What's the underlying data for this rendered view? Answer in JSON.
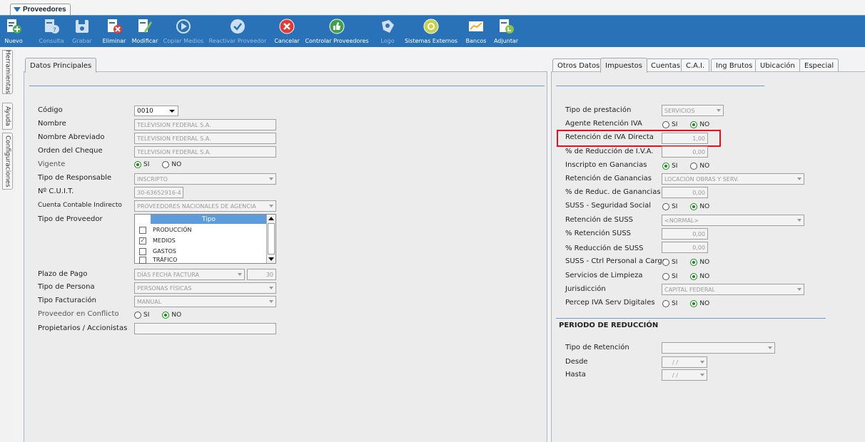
{
  "window": {
    "tab_title": "Proveedores"
  },
  "toolbar": [
    {
      "label": "Nuevo",
      "icon": "new-doc-icon",
      "enabled": true
    },
    {
      "label": "Consulta",
      "icon": "query-doc-icon",
      "enabled": false
    },
    {
      "label": "Grabar",
      "icon": "save-icon",
      "enabled": false
    },
    {
      "label": "Eliminar",
      "icon": "delete-doc-icon",
      "enabled": true
    },
    {
      "label": "Modificar",
      "icon": "edit-icon",
      "enabled": true
    },
    {
      "label": "Copiar Medios",
      "icon": "play-circle-icon",
      "enabled": false
    },
    {
      "label": "Reactivar Proveedor",
      "icon": "check-circle-icon",
      "enabled": false
    },
    {
      "label": "Cancelar",
      "icon": "cancel-icon",
      "enabled": true
    },
    {
      "label": "Controlar Proveedores",
      "icon": "thumbs-up-icon",
      "enabled": true
    },
    {
      "label": "Logo",
      "icon": "logo-icon",
      "enabled": false
    },
    {
      "label": "Sistemas Externos",
      "icon": "external-systems-icon",
      "enabled": true
    },
    {
      "label": "Bancos",
      "icon": "chart-icon",
      "enabled": true
    },
    {
      "label": "Adjuntar",
      "icon": "attach-doc-icon",
      "enabled": true
    }
  ],
  "side_tabs": [
    "Herramientas",
    "Ayuda",
    "Configuraciones"
  ],
  "left": {
    "tab": "Datos Principales",
    "codigo_label": "Código",
    "codigo_value": "0010",
    "nombre_label": "Nombre",
    "nombre_value": "TELEVISION FEDERAL S.A.",
    "nombre_abrev_label": "Nombre Abreviado",
    "nombre_abrev_value": "TELEVISION FEDERAL S.A.",
    "orden_label": "Orden del Cheque",
    "orden_value": "TELEVISION FEDERAL S.A.",
    "vigente_label": "Vigente",
    "tipo_resp_label": "Tipo de Responsable",
    "tipo_resp_value": "INSCRIPTO",
    "cuit_label": "Nº C.U.I.T.",
    "cuit_value": "30-63652916-4",
    "cuenta_label": "Cuenta Contable Indirecto",
    "cuenta_value": "PROVEEDORES NACIONALES DE AGENCIA",
    "tipo_prov_label": "Tipo de Proveedor",
    "grid_header": "Tipo",
    "grid_rows": [
      {
        "label": "PRODUCCIÓN",
        "checked": false
      },
      {
        "label": "MEDIOS",
        "checked": true
      },
      {
        "label": "GASTOS",
        "checked": false
      },
      {
        "label": "TRÁFICO",
        "checked": false
      }
    ],
    "plazo_label": "Plazo de Pago",
    "plazo_value": "DÍAS FECHA FACTURA",
    "plazo_days": "30",
    "tipo_persona_label": "Tipo de Persona",
    "tipo_persona_value": "PERSONAS FÍSICAS",
    "tipo_fact_label": "Tipo Facturación",
    "tipo_fact_value": "MANUAL",
    "conflicto_label": "Proveedor en Conflicto",
    "propietarios_label": "Propietarios / Accionistas",
    "propietarios_value": "",
    "si_label": "SI",
    "no_label": "NO"
  },
  "right": {
    "tabs": [
      "Otros Datos",
      "Impuestos",
      "Cuentas",
      "C.A.I.",
      "Ing Brutos",
      "Ubicación",
      "Especial"
    ],
    "active_tab": "Impuestos",
    "tipo_prest_label": "Tipo de prestación",
    "tipo_prest_value": "SERVICIOS",
    "agente_ret_iva_label": "Agente Retención IVA",
    "ret_iva_directa_label": "Retención de IVA Directa",
    "ret_iva_directa_value": "1,00",
    "red_iva_label": "% de Reducción de I.V.A.",
    "red_iva_value": "0,00",
    "inscripto_gan_label": "Inscripto en Ganancias",
    "ret_gan_label": "Retención de Ganancias",
    "ret_gan_value": "LOCACIÓN OBRAS Y SERV.",
    "red_gan_label": "% de Reduc. de Ganancias",
    "red_gan_value": "0,00",
    "suss_label": "SUSS - Seguridad Social",
    "ret_suss_label": "Retención de SUSS",
    "ret_suss_value": "<NORMAL>",
    "pct_ret_suss_label": "% Retención SUSS",
    "pct_ret_suss_value": "0,00",
    "pct_red_suss_label": "% Reducción de SUSS",
    "pct_red_suss_value": "0,00",
    "suss_ctrl_label": "SUSS - Ctrl Personal a Cargo",
    "limpieza_label": "Servicios de Limpieza",
    "jurisdiccion_label": "Jurisdicción",
    "jurisdiccion_value": "CAPITAL FEDERAL",
    "percep_label": "Percep IVA Serv Digitales",
    "periodo_title": "PERIODO DE REDUCCIÓN",
    "tipo_ret_label": "Tipo de Retención",
    "tipo_ret_value": "",
    "desde_label": "Desde",
    "desde_value": "/  /",
    "hasta_label": "Hasta",
    "hasta_value": "/  /",
    "si_label": "SI",
    "no_label": "NO"
  },
  "colors": {
    "toolbar": "#2a72b8",
    "highlight": "#e0141e",
    "grid_header": "#5d9bdb"
  }
}
